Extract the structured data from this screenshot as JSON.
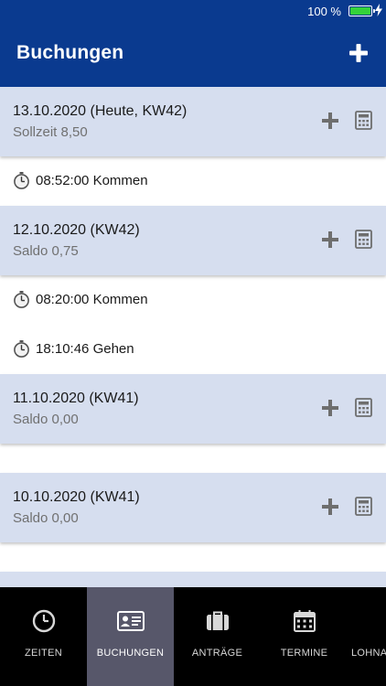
{
  "status_bar": {
    "battery_text": "100 %"
  },
  "app_bar": {
    "title": "Buchungen"
  },
  "days": [
    {
      "date": "13.10.2020 (Heute, KW42)",
      "sub": "Sollzeit 8,50",
      "bookings": [
        {
          "time": "08:52:00",
          "type": "Kommen"
        }
      ]
    },
    {
      "date": "12.10.2020 (KW42)",
      "sub": "Saldo 0,75",
      "bookings": [
        {
          "time": "08:20:00",
          "type": "Kommen"
        },
        {
          "time": "18:10:46",
          "type": "Gehen"
        }
      ]
    },
    {
      "date": "11.10.2020 (KW41)",
      "sub": "Saldo 0,00",
      "bookings": []
    },
    {
      "date": "10.10.2020 (KW41)",
      "sub": "Saldo 0,00",
      "bookings": []
    }
  ],
  "nav": [
    {
      "label": "ZEITEN",
      "icon": "clock-icon",
      "active": false
    },
    {
      "label": "BUCHUNGEN",
      "icon": "id-card-icon",
      "active": true
    },
    {
      "label": "ANTRÄGE",
      "icon": "briefcase-icon",
      "active": false
    },
    {
      "label": "TERMINE",
      "icon": "calendar-icon",
      "active": false
    },
    {
      "label": "LOHNA",
      "icon": "wallet-icon",
      "active": false
    }
  ],
  "colors": {
    "app_bar": "#0a3a8f",
    "day_card": "#d6deef",
    "nav_background": "#000000",
    "nav_active": "#57576a",
    "battery": "#34d23a",
    "icon_grey": "#6e6e6e"
  }
}
